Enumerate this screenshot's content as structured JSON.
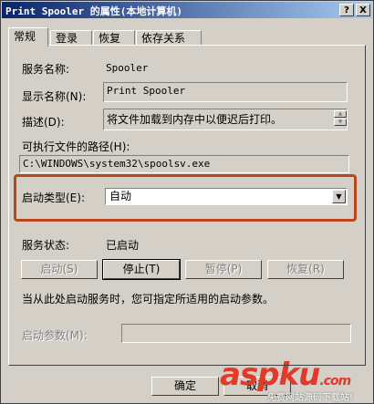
{
  "window": {
    "title": "Print Spooler 的属性(本地计算机)",
    "help_btn": "?",
    "close_btn": "X"
  },
  "tabs": [
    {
      "label": "常规"
    },
    {
      "label": "登录"
    },
    {
      "label": "恢复"
    },
    {
      "label": "依存关系"
    }
  ],
  "general": {
    "service_name_label": "服务名称:",
    "service_name": "Spooler",
    "display_name_label": "显示名称(N):",
    "display_name": "Print Spooler",
    "description_label": "描述(D):",
    "description": "将文件加载到内存中以便迟后打印。",
    "exe_path_label": "可执行文件的路径(H):",
    "exe_path": "C:\\WINDOWS\\system32\\spoolsv.exe",
    "startup_type_label": "启动类型(E):",
    "startup_type_value": "自动",
    "status_label": "服务状态:",
    "status_value": "已启动",
    "buttons": {
      "start": "启动(S)",
      "stop": "停止(T)",
      "pause": "暂停(P)",
      "resume": "恢复(R)"
    },
    "hint": "当从此处启动服务时，您可指定所适用的启动参数。",
    "start_params_label": "启动参数(M):",
    "start_params_value": ""
  },
  "footer": {
    "ok": "确定",
    "cancel": "取消"
  },
  "watermark": {
    "brand": "aspku",
    "brand_suffix": ".com",
    "tagline": "免费网站源码下载站!"
  },
  "colors": {
    "highlight_border": "#b8471c",
    "title_gradient_start": "#0a246a",
    "watermark": "#e03a2a"
  }
}
